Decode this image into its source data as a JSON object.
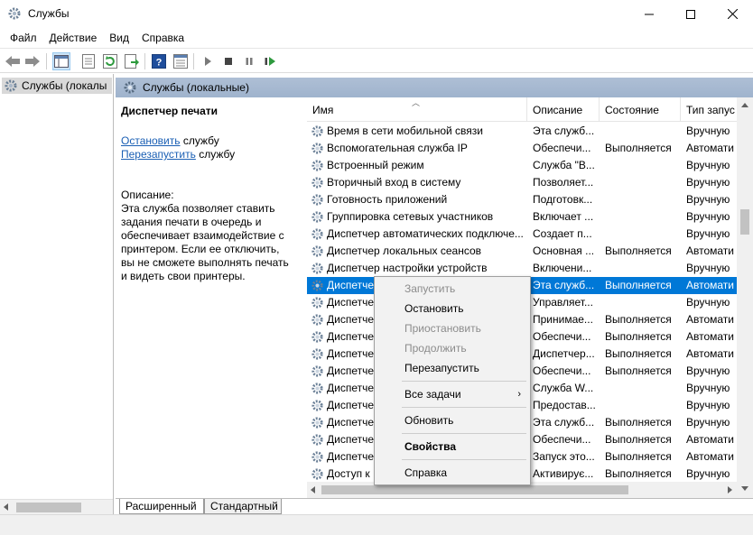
{
  "window": {
    "title": "Службы",
    "accent": "#0078d7"
  },
  "menu": [
    "Файл",
    "Действие",
    "Вид",
    "Справка"
  ],
  "toolbar": {
    "icons": [
      "back-icon",
      "forward-icon",
      "show-tree-icon",
      "properties-icon",
      "refresh-icon",
      "export-icon",
      "help-icon",
      "view-icon",
      "start-icon",
      "stop-icon",
      "pause-icon",
      "restart-icon"
    ]
  },
  "tree": {
    "item": "Службы (локалы"
  },
  "header": {
    "title": "Службы (локальные)"
  },
  "details": {
    "service_name": "Диспетчер печати",
    "stop_link": "Остановить",
    "stop_suffix": " службу",
    "restart_link": "Перезапустить",
    "restart_suffix": " службу",
    "desc_label": "Описание:",
    "desc_text": "Эта служба позволяет ставить задания печати в очередь и обеспечивает взаимодействие с принтером. Если ее отключить, вы не сможете выполнять печать и видеть свои принтеры."
  },
  "columns": {
    "name": "Имя",
    "desc": "Описание",
    "state": "Состояние",
    "stype": "Тип запус"
  },
  "rows": [
    {
      "name": "Время в сети мобильной связи",
      "desc": "Эта служб...",
      "state": "",
      "stype": "Вручную"
    },
    {
      "name": "Вспомогательная служба IP",
      "desc": "Обеспечи...",
      "state": "Выполняется",
      "stype": "Автомати"
    },
    {
      "name": "Встроенный режим",
      "desc": "Служба \"В...",
      "state": "",
      "stype": "Вручную"
    },
    {
      "name": "Вторичный вход в систему",
      "desc": "Позволяет...",
      "state": "",
      "stype": "Вручную"
    },
    {
      "name": "Готовность приложений",
      "desc": "Подготовк...",
      "state": "",
      "stype": "Вручную"
    },
    {
      "name": "Группировка сетевых участников",
      "desc": "Включает ...",
      "state": "",
      "stype": "Вручную"
    },
    {
      "name": "Диспетчер автоматических подключе...",
      "desc": "Создает п...",
      "state": "",
      "stype": "Вручную"
    },
    {
      "name": "Диспетчер локальных сеансов",
      "desc": "Основная ...",
      "state": "Выполняется",
      "stype": "Автомати"
    },
    {
      "name": "Диспетчер настройки устройств",
      "desc": "Включени...",
      "state": "",
      "stype": "Вручную"
    },
    {
      "name": "Диспетчер печати",
      "desc": "Эта служб...",
      "state": "Выполняется",
      "stype": "Автомати"
    },
    {
      "name": "Диспетчер",
      "desc": "Управляет...",
      "state": "",
      "stype": "Вручную"
    },
    {
      "name": "Диспетчер",
      "desc": "Принимае...",
      "state": "Выполняется",
      "stype": "Автомати"
    },
    {
      "name": "Диспетчер",
      "desc": "Обеспечи...",
      "state": "Выполняется",
      "stype": "Автомати"
    },
    {
      "name": "Диспетчер",
      "desc": "Диспетчер...",
      "state": "Выполняется",
      "stype": "Автомати"
    },
    {
      "name": "Диспетчер",
      "desc": "Обеспечи...",
      "state": "Выполняется",
      "stype": "Вручную"
    },
    {
      "name": "Диспетчер",
      "desc": "Служба W...",
      "state": "",
      "stype": "Вручную"
    },
    {
      "name": "Диспетчер",
      "desc": "Предостав...",
      "state": "",
      "stype": "Вручную"
    },
    {
      "name": "Диспетчер",
      "desc": "Эта служб...",
      "state": "Выполняется",
      "stype": "Вручную"
    },
    {
      "name": "Диспетчер",
      "desc": "Обеспечи...",
      "state": "Выполняется",
      "stype": "Автомати"
    },
    {
      "name": "Диспетчер",
      "desc": "Запуск это...",
      "state": "Выполняется",
      "stype": "Автомати"
    },
    {
      "name": "Доступ к",
      "desc": "Активирує...",
      "state": "Выполняется",
      "stype": "Вручную"
    }
  ],
  "selected_row": 9,
  "context_menu": {
    "start": "Запустить",
    "stop": "Остановить",
    "pause": "Приостановить",
    "resume": "Продолжить",
    "restart": "Перезапустить",
    "all_tasks": "Все задачи",
    "refresh": "Обновить",
    "properties": "Свойства",
    "help": "Справка"
  },
  "tabs": [
    "Расширенный",
    "Стандартный"
  ]
}
